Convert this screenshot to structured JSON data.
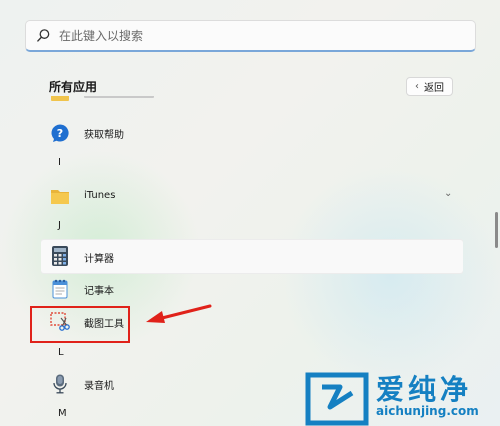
{
  "search": {
    "placeholder": "在此键入以搜索"
  },
  "header": {
    "title": "所有应用",
    "back_label": "返回"
  },
  "apps": [
    {
      "label": "获取帮助",
      "icon": "help-icon"
    },
    {
      "letter": "I"
    },
    {
      "label": "iTunes",
      "icon": "folder-icon",
      "expandable": true
    },
    {
      "letter": "J"
    },
    {
      "label": "计算器",
      "icon": "calculator-icon"
    },
    {
      "label": "记事本",
      "icon": "notepad-icon"
    },
    {
      "label": "截图工具",
      "icon": "snipping-tool-icon"
    },
    {
      "letter": "L"
    },
    {
      "label": "录音机",
      "icon": "voice-recorder-icon"
    },
    {
      "letter": "M"
    }
  ],
  "annotation": {
    "color": "#e0221a"
  },
  "watermark": {
    "brand": "爱纯净",
    "url": "aichunjing.com",
    "color": "#1580c2"
  },
  "colors": {
    "accent": "#7aa7d9"
  }
}
